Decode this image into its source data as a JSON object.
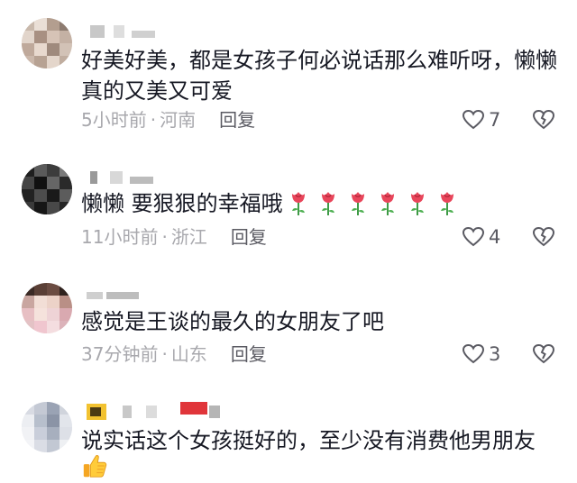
{
  "comments": [
    {
      "text": "好美好美，都是女孩子何必说话那么难听呀，懒懒真的又美又可爱",
      "time": "5小时前",
      "region": "河南",
      "reply": "回复",
      "likes": "7"
    },
    {
      "text": "懒懒 要狠狠的幸福哦",
      "emoji": "rose-icon",
      "emoji_count": 6,
      "time": "11小时前",
      "region": "浙江",
      "reply": "回复",
      "likes": "4"
    },
    {
      "text": "感觉是王谈的最久的女朋友了吧",
      "time": "37分钟前",
      "region": "山东",
      "reply": "回复",
      "likes": "3"
    },
    {
      "text": "说实话这个女孩挺好的，至少没有消费他男朋友",
      "emoji": "thumbs-up-icon"
    }
  ],
  "meta_separator": "·",
  "colors": {
    "text": "#161823",
    "meta": "#a8a8ad",
    "reply": "#5a5a62",
    "rose": "#e8455a"
  }
}
